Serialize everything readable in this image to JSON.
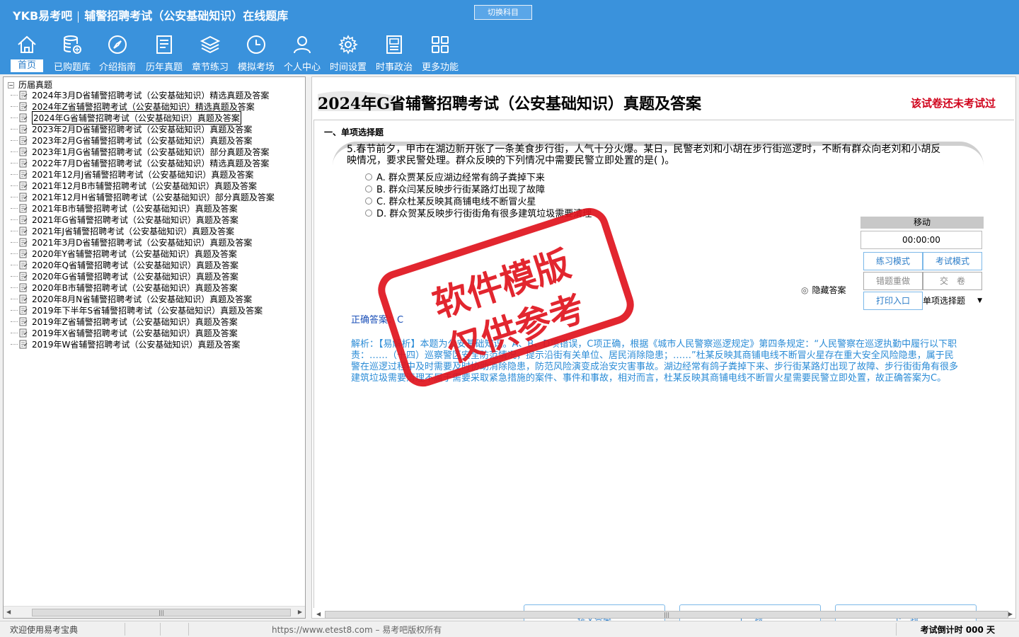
{
  "header": {
    "brand": "YKB易考吧",
    "title": "辅警招聘考试（公安基础知识）在线题库",
    "switch_label": "切换科目",
    "nav": [
      {
        "label": "首页",
        "icon": "home-icon"
      },
      {
        "label": "已购题库",
        "icon": "database-icon"
      },
      {
        "label": "介绍指南",
        "icon": "compass-icon"
      },
      {
        "label": "历年真题",
        "icon": "document-list-icon"
      },
      {
        "label": "章节练习",
        "icon": "layers-icon"
      },
      {
        "label": "模拟考场",
        "icon": "clock-icon"
      },
      {
        "label": "个人中心",
        "icon": "user-icon"
      },
      {
        "label": "时间设置",
        "icon": "gear-icon"
      },
      {
        "label": "时事政治",
        "icon": "newspaper-icon"
      },
      {
        "label": "更多功能",
        "icon": "grid-icon"
      }
    ]
  },
  "tree": {
    "root": "历届真题",
    "items": [
      "2024年3月D省辅警招聘考试（公安基础知识）精选真题及答案",
      "2024年Z省辅警招聘考试（公安基础知识）精选真题及答案",
      "2024年G省辅警招聘考试（公安基础知识）真题及答案",
      "2023年2月D省辅警招聘考试（公安基础知识）真题及答案",
      "2023年2月G省辅警招聘考试（公安基础知识）真题及答案",
      "2023年1月G省辅警招聘考试（公安基础知识）部分真题及答案",
      "2022年7月D省辅警招聘考试（公安基础知识）精选真题及答案",
      "2021年12月J省辅警招聘考试（公安基础知识）真题及答案",
      "2021年12月B市辅警招聘考试（公安基础知识）真题及答案",
      "2021年12月H省辅警招聘考试（公安基础知识）部分真题及答案",
      "2021年B市辅警招聘考试（公安基础知识）真题及答案",
      "2021年G省辅警招聘考试（公安基础知识）真题及答案",
      "2021年J省辅警招聘考试（公安基础知识）真题及答案",
      "2021年3月D省辅警招聘考试（公安基础知识）真题及答案",
      "2020年Y省辅警招聘考试（公安基础知识）真题及答案",
      "2020年Q省辅警招聘考试（公安基础知识）真题及答案",
      "2020年G省辅警招聘考试（公安基础知识）真题及答案",
      "2020年B市辅警招聘考试（公安基础知识）真题及答案",
      "2020年8月N省辅警招聘考试（公安基础知识）真题及答案",
      "2019年下半年S省辅警招聘考试（公安基础知识）真题及答案",
      "2019年Z省辅警招聘考试（公安基础知识）真题及答案",
      "2019年X省辅警招聘考试（公安基础知识）真题及答案",
      "2019年W省辅警招聘考试（公安基础知识）真题及答案"
    ],
    "selected_index": 2
  },
  "paper": {
    "title": "2024年G省辅警招聘考试（公安基础知识）真题及答案",
    "status": "该试卷还未考试过",
    "section": "一、单项选择题"
  },
  "question": {
    "stem": "5.春节前夕，甲市在湖边新开张了一条美食步行街，人气十分火爆。某日，民警老刘和小胡在步行街巡逻时，不断有群众向老刘和小胡反映情况，要求民警处理。群众反映的下列情况中需要民警立即处置的是( )。",
    "options": [
      "A. 群众贾某反应湖边经常有鸽子粪掉下来",
      "B. 群众闫某反映步行街某路灯出现了故障",
      "C. 群众杜某反映其商铺电线不断冒火星",
      "D. 群众贺某反映步行街街角有很多建筑垃圾需要清理"
    ],
    "hide_answer_label": "隐藏答案",
    "correct_answer": "正确答案：C",
    "analysis": "解析：【易解析】本题为公安基础知识。A、B、D项错误，C项正确，根据《城市人民警察巡逻规定》第四条规定：“人民警察在巡逻执勤中履行以下职责：……（十四）巡察警区安全防范情况，提示沿街有关单位、居民消除隐患；……”杜某反映其商铺电线不断冒火星存在重大安全风险隐患，属于民警在巡逻过程中及时需要及时协助消除隐患，防范风险演变成治安灾害事故。湖边经常有鸽子粪掉下来、步行街某路灯出现了故障、步行街街角有很多建筑垃圾需要清理不属于需要采取紧急措施的案件、事件和事故，相对而言，杜某反映其商铺电线不断冒火星需要民警立即处置，故正确答案为C。"
  },
  "controls": {
    "move_label": "移动",
    "timer": "00:00:00",
    "practice_mode": "练习模式",
    "exam_mode": "考试模式",
    "redo_wrong": "错题重做",
    "submit_paper": "交　卷",
    "print_entry": "打印入口",
    "type_select": "单项选择题"
  },
  "nav_buttons": {
    "submit": "提交答案",
    "prev": "上一题",
    "next": "下一题"
  },
  "status_bar": {
    "welcome": "欢迎使用易考宝典",
    "copyright": "https://www.etest8.com – 易考吧版权所有",
    "countdown": "考试倒计时 000 天"
  },
  "watermark": {
    "line1": "软件模版",
    "line2": "仅供参考"
  },
  "colors": {
    "header_bg": "#3a92dc",
    "status_red": "#d0021b",
    "answer_blue": "#1a4fb8",
    "analysis_blue": "#2a8bd6",
    "stamp_red": "#e0141e"
  }
}
